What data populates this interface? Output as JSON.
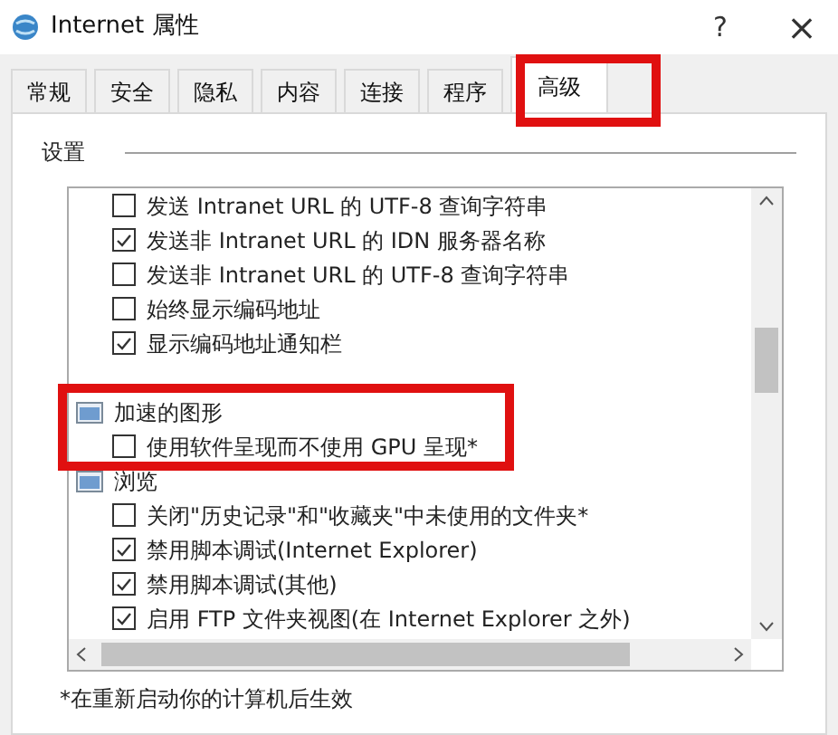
{
  "window": {
    "title": "Internet 属性",
    "help": "?",
    "close": "×"
  },
  "tabs": [
    {
      "label": "常规",
      "selected": false
    },
    {
      "label": "安全",
      "selected": false
    },
    {
      "label": "隐私",
      "selected": false
    },
    {
      "label": "内容",
      "selected": false
    },
    {
      "label": "连接",
      "selected": false
    },
    {
      "label": "程序",
      "selected": false
    },
    {
      "label": "高级",
      "selected": true
    }
  ],
  "section_label": "设置",
  "settings_list": [
    {
      "kind": "checkbox",
      "label": "发送 Intranet URL 的 UTF-8 查询字符串",
      "checked": false
    },
    {
      "kind": "checkbox",
      "label": "发送非 Intranet URL 的 IDN 服务器名称",
      "checked": true
    },
    {
      "kind": "checkbox",
      "label": "发送非 Intranet URL 的 UTF-8 查询字符串",
      "checked": false
    },
    {
      "kind": "checkbox",
      "label": "始终显示编码地址",
      "checked": false
    },
    {
      "kind": "checkbox",
      "label": "显示编码地址通知栏",
      "checked": true
    },
    {
      "kind": "group",
      "label": "加速的图形",
      "children": [
        {
          "kind": "checkbox",
          "label": "使用软件呈现而不使用 GPU 呈现*",
          "checked": false
        }
      ]
    },
    {
      "kind": "group",
      "label": "浏览",
      "children": [
        {
          "kind": "checkbox",
          "label": "关闭\"历史记录\"和\"收藏夹\"中未使用的文件夹*",
          "checked": false
        },
        {
          "kind": "checkbox",
          "label": "禁用脚本调试(Internet Explorer)",
          "checked": true
        },
        {
          "kind": "checkbox",
          "label": "禁用脚本调试(其他)",
          "checked": true
        },
        {
          "kind": "checkbox",
          "label": "启用 FTP 文件夹视图(在 Internet Explorer 之外)",
          "checked": true
        }
      ]
    }
  ],
  "footnote": "*在重新启动你的计算机后生效"
}
